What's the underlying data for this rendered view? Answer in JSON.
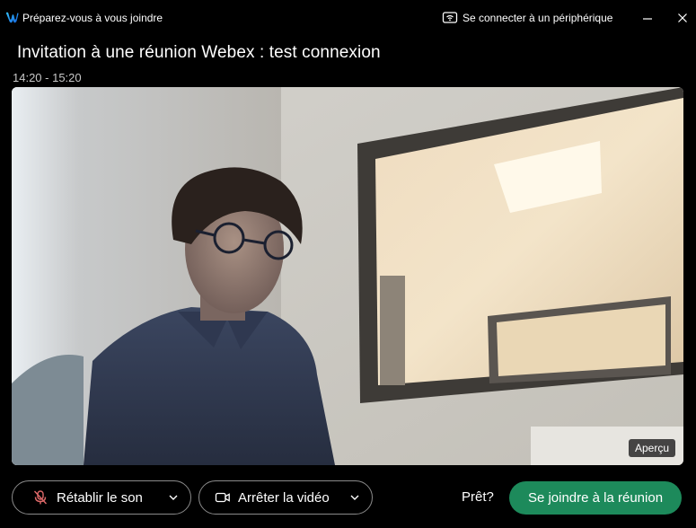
{
  "window": {
    "title": "Préparez-vous à vous joindre",
    "connect_device_label": "Se connecter à un périphérique"
  },
  "meeting": {
    "title": "Invitation à une réunion Webex : test connexion",
    "time": "14:20 - 15:20"
  },
  "preview": {
    "badge": "Aperçu"
  },
  "controls": {
    "audio_label": "Rétablir le son",
    "video_label": "Arrêter la vidéo",
    "ready_text": "Prêt?",
    "join_label": "Se joindre à la réunion"
  },
  "icons": {
    "app_logo": "webex-logo-icon",
    "connect_device": "wifi-device-icon",
    "audio": "microphone-muted-icon",
    "video": "video-camera-icon",
    "caret": "chevron-down-icon"
  },
  "colors": {
    "background": "#000000",
    "join_button": "#1d8a5b",
    "muted_mic": "#e06a6a",
    "pill_border": "#8a8a8a"
  }
}
